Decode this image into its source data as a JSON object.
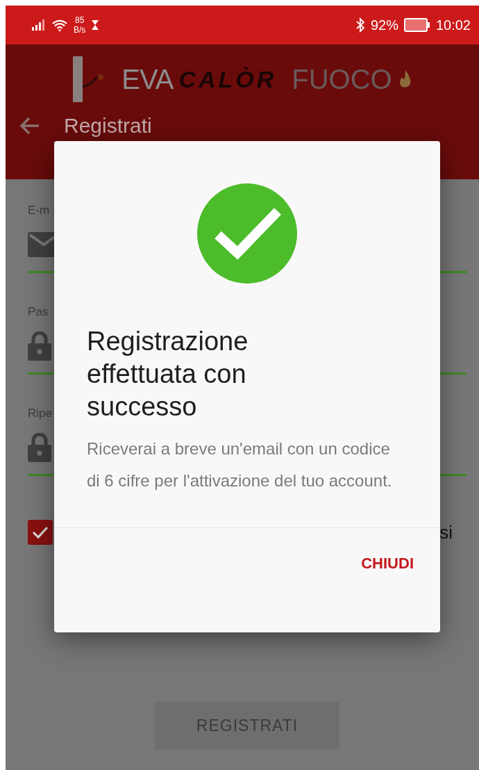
{
  "status_bar": {
    "net_speed": "85",
    "net_unit": "B/s",
    "battery": "92%",
    "time": "10:02"
  },
  "logo": {
    "parts": [
      "EVA",
      "CALÒR",
      "FUOCO"
    ]
  },
  "toolbar": {
    "title": "Registrati"
  },
  "form": {
    "fields": [
      {
        "label": "E-m",
        "kind": "email"
      },
      {
        "label": "Pas",
        "kind": "password"
      },
      {
        "label": "Ripe",
        "kind": "password"
      }
    ],
    "checkbox": {
      "checked": true,
      "label": "si"
    },
    "submit": {
      "label": "REGISTRATI",
      "disabled": true
    }
  },
  "dialog": {
    "title": "Registrazione effettuata con successo",
    "message": "Riceverai a breve un'email con un codice di 6 cifre per l'attivazione del tuo account.",
    "button": "CHIUDI"
  }
}
